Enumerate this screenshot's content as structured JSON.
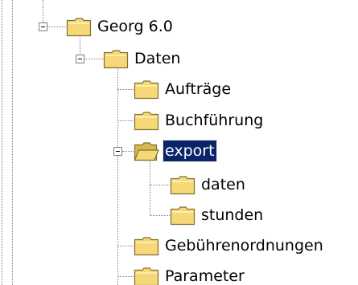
{
  "tree": {
    "nodes": [
      {
        "id": "georg",
        "label": "Georg 6.0",
        "expanded": true,
        "selected": false,
        "folder_open": false
      },
      {
        "id": "daten",
        "label": "Daten",
        "expanded": true,
        "selected": false,
        "folder_open": false
      },
      {
        "id": "auftraege",
        "label": "Aufträge",
        "expanded": false,
        "selected": false,
        "folder_open": false
      },
      {
        "id": "buchfuehrung",
        "label": "Buchführung",
        "expanded": false,
        "selected": false,
        "folder_open": false
      },
      {
        "id": "export",
        "label": "export",
        "expanded": true,
        "selected": true,
        "folder_open": true
      },
      {
        "id": "export-daten",
        "label": "daten",
        "expanded": false,
        "selected": false,
        "folder_open": false
      },
      {
        "id": "stunden",
        "label": "stunden",
        "expanded": false,
        "selected": false,
        "folder_open": false
      },
      {
        "id": "gebuehren",
        "label": "Gebührenordnungen",
        "expanded": false,
        "selected": false,
        "folder_open": false
      },
      {
        "id": "parameter",
        "label": "Parameter",
        "expanded": false,
        "selected": false,
        "folder_open": false
      }
    ]
  },
  "colors": {
    "selection_bg": "#0a246a",
    "folder_fill": "#f6d878",
    "folder_outline": "#807030",
    "tree_lines": "#808080"
  },
  "icons": {
    "folder_closed": "folder-closed-icon",
    "folder_open": "folder-open-icon",
    "collapse": "minus-box-icon"
  }
}
